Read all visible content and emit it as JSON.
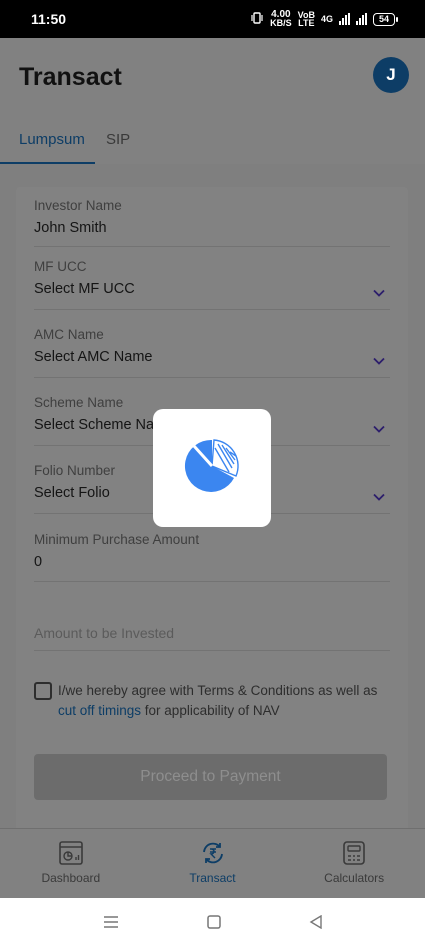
{
  "status": {
    "time": "11:50",
    "speed_value": "4.00",
    "speed_unit": "KB/S",
    "volte": "VoB",
    "lte": "LTE",
    "net_type": "4G",
    "battery": "54"
  },
  "header": {
    "title": "Transact",
    "avatar_initial": "J"
  },
  "tabs": [
    {
      "label": "Lumpsum",
      "active": true
    },
    {
      "label": "SIP",
      "active": false
    }
  ],
  "form": {
    "investor_name": {
      "label": "Investor Name",
      "value": "John Smith"
    },
    "mf_ucc": {
      "label": "MF UCC",
      "value": "Select MF UCC"
    },
    "amc_name": {
      "label": "AMC Name",
      "value": "Select AMC Name"
    },
    "scheme_name": {
      "label": "Scheme Name",
      "value": "Select Scheme Name"
    },
    "folio_number": {
      "label": "Folio Number",
      "value": "Select Folio"
    },
    "min_purchase": {
      "label": "Minimum Purchase Amount",
      "value": "0"
    },
    "amount": {
      "placeholder": "Amount to be Invested"
    },
    "agree_text_1": "I/we hereby agree with Terms & Conditions as well as ",
    "agree_link": "cut off timings",
    "agree_text_2": " for applicability of NAV",
    "proceed_label": "Proceed to Payment"
  },
  "bottom_nav": [
    {
      "label": "Dashboard",
      "icon": "dashboard-icon",
      "active": false
    },
    {
      "label": "Transact",
      "icon": "rupee-exchange-icon",
      "active": true
    },
    {
      "label": "Calculators",
      "icon": "calculator-icon",
      "active": false
    }
  ],
  "colors": {
    "brand": "#0d3d66",
    "loader_blue": "#3b86f0"
  }
}
